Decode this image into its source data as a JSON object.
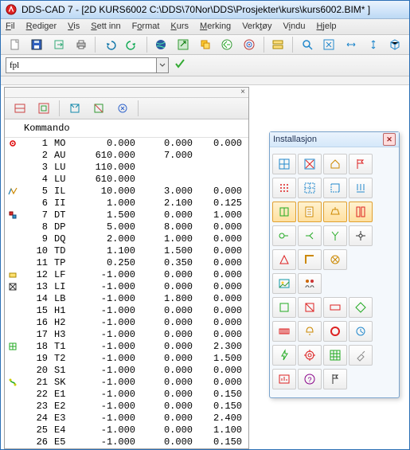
{
  "window": {
    "title": "DDS-CAD 7 - [2D  KURS6002  C:\\DDS\\70Nor\\DDS\\Prosjekter\\kurs\\kurs6002.BIM* ]"
  },
  "menu": {
    "fil": "Fil",
    "rediger": "Rediger",
    "vis": "Vis",
    "settinn": "Sett inn",
    "format": "Format",
    "kurs": "Kurs",
    "merking": "Merking",
    "verktoy": "Verktøy",
    "vindu": "Vindu",
    "hjelp": "Hjelp"
  },
  "cmd": {
    "value": "fpl"
  },
  "panel": {
    "header": "Kommando"
  },
  "palette": {
    "title": "Installasjon"
  },
  "rows": [
    {
      "idx": "1",
      "code": "MO",
      "a": "0.000",
      "b": "0.000",
      "c": "0.000",
      "icon": "dot-red"
    },
    {
      "idx": "2",
      "code": "AU",
      "a": "610.000",
      "b": "7.000",
      "c": "",
      "icon": ""
    },
    {
      "idx": "3",
      "code": "LU",
      "a": "110.000",
      "b": "",
      "c": "",
      "icon": ""
    },
    {
      "idx": "4",
      "code": "LU",
      "a": "610.000",
      "b": "",
      "c": "",
      "icon": ""
    },
    {
      "idx": "5",
      "code": "IL",
      "a": "10.000",
      "b": "3.000",
      "c": "0.000",
      "icon": "zig"
    },
    {
      "idx": "6",
      "code": "II",
      "a": "1.000",
      "b": "2.100",
      "c": "0.125",
      "icon": ""
    },
    {
      "idx": "7",
      "code": "DT",
      "a": "1.500",
      "b": "0.000",
      "c": "1.000",
      "icon": "blocks"
    },
    {
      "idx": "8",
      "code": "DP",
      "a": "5.000",
      "b": "8.000",
      "c": "0.000",
      "icon": ""
    },
    {
      "idx": "9",
      "code": "DQ",
      "a": "2.000",
      "b": "1.000",
      "c": "0.000",
      "icon": ""
    },
    {
      "idx": "10",
      "code": "TD",
      "a": "1.100",
      "b": "1.500",
      "c": "0.000",
      "icon": ""
    },
    {
      "idx": "11",
      "code": "TP",
      "a": "0.250",
      "b": "0.350",
      "c": "0.000",
      "icon": ""
    },
    {
      "idx": "12",
      "code": "LF",
      "a": "-1.000",
      "b": "0.000",
      "c": "0.000",
      "icon": "rect-y"
    },
    {
      "idx": "13",
      "code": "LI",
      "a": "-1.000",
      "b": "0.000",
      "c": "0.000",
      "icon": "cross-box"
    },
    {
      "idx": "14",
      "code": "LB",
      "a": "-1.000",
      "b": "1.800",
      "c": "0.000",
      "icon": ""
    },
    {
      "idx": "15",
      "code": "H1",
      "a": "-1.000",
      "b": "0.000",
      "c": "0.000",
      "icon": ""
    },
    {
      "idx": "16",
      "code": "H2",
      "a": "-1.000",
      "b": "0.000",
      "c": "0.000",
      "icon": ""
    },
    {
      "idx": "17",
      "code": "H3",
      "a": "-1.000",
      "b": "0.000",
      "c": "0.000",
      "icon": ""
    },
    {
      "idx": "18",
      "code": "T1",
      "a": "-1.000",
      "b": "0.000",
      "c": "2.300",
      "icon": "tee-g"
    },
    {
      "idx": "19",
      "code": "T2",
      "a": "-1.000",
      "b": "0.000",
      "c": "1.500",
      "icon": ""
    },
    {
      "idx": "20",
      "code": "S1",
      "a": "-1.000",
      "b": "0.000",
      "c": "0.000",
      "icon": ""
    },
    {
      "idx": "21",
      "code": "SK",
      "a": "-1.000",
      "b": "0.000",
      "c": "0.000",
      "icon": "sk"
    },
    {
      "idx": "22",
      "code": "E1",
      "a": "-1.000",
      "b": "0.000",
      "c": "0.150",
      "icon": ""
    },
    {
      "idx": "23",
      "code": "E2",
      "a": "-1.000",
      "b": "0.000",
      "c": "0.150",
      "icon": ""
    },
    {
      "idx": "24",
      "code": "E3",
      "a": "-1.000",
      "b": "0.000",
      "c": "2.400",
      "icon": ""
    },
    {
      "idx": "25",
      "code": "E4",
      "a": "-1.000",
      "b": "0.000",
      "c": "1.100",
      "icon": ""
    },
    {
      "idx": "26",
      "code": "E5",
      "a": "-1.000",
      "b": "0.000",
      "c": "0.150",
      "icon": ""
    }
  ]
}
